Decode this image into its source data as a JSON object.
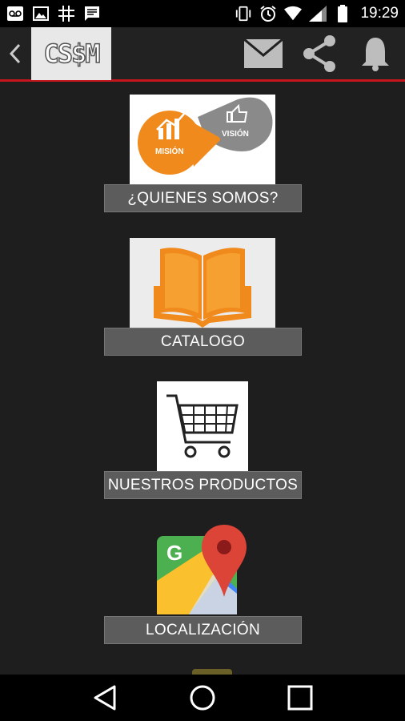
{
  "status_bar": {
    "time": "19:29",
    "icons": [
      "voicemail-icon",
      "image-icon",
      "grid-icon",
      "message-icon",
      "vibrate-icon",
      "alarm-icon",
      "wifi-icon",
      "signal-icon",
      "battery-icon"
    ]
  },
  "app_bar": {
    "logo_text": "CS$M",
    "actions": [
      "mail-icon",
      "share-icon",
      "bell-icon"
    ],
    "accent_color": "#c4161c"
  },
  "menu": {
    "items": [
      {
        "label": "¿QUIENES SOMOS?",
        "icon": "mission-vision-icon",
        "image_text_1": "MISIÓN",
        "image_text_2": "VISIÓN"
      },
      {
        "label": "CATALOGO",
        "icon": "book-icon"
      },
      {
        "label": "NUESTROS PRODUCTOS",
        "icon": "shopping-cart-icon"
      },
      {
        "label": "LOCALIZACIÓN",
        "icon": "google-maps-icon",
        "image_text_1": "G"
      }
    ]
  },
  "nav_bar": {
    "buttons": [
      "back-triangle-icon",
      "home-circle-icon",
      "recents-square-icon"
    ]
  },
  "colors": {
    "orange": "#f08a1c",
    "label_bg": "#5c5c5c",
    "background": "#1e1e1e"
  }
}
